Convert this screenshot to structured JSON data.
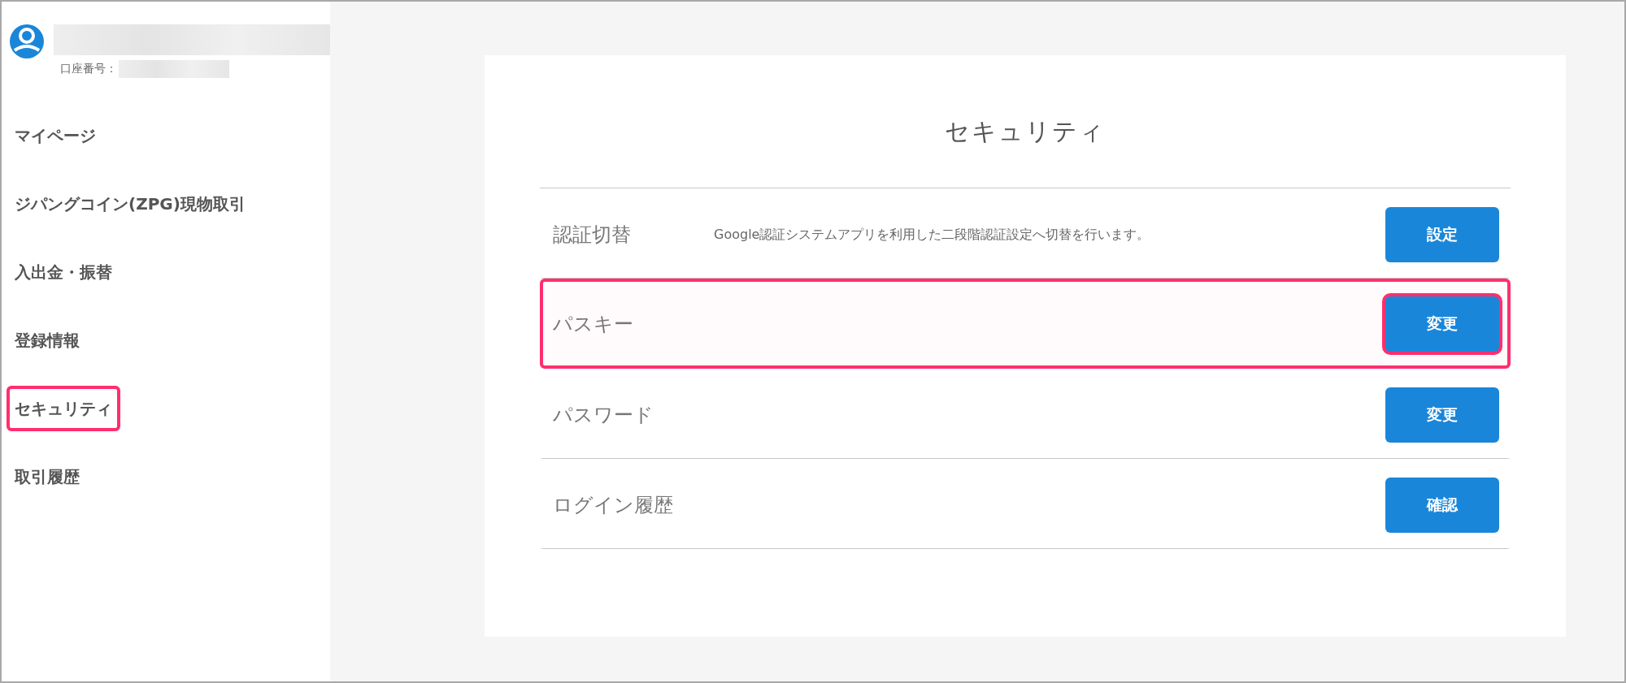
{
  "account": {
    "account_number_label": "口座番号："
  },
  "sidebar": {
    "items": [
      {
        "label": "マイページ",
        "highlighted": false
      },
      {
        "label": "ジパングコイン(ZPG)現物取引",
        "highlighted": false
      },
      {
        "label": "入出金・振替",
        "highlighted": false
      },
      {
        "label": "登録情報",
        "highlighted": false
      },
      {
        "label": "セキュリティ",
        "highlighted": true
      },
      {
        "label": "取引履歴",
        "highlighted": false
      }
    ]
  },
  "panel": {
    "title": "セキュリティ",
    "rows": [
      {
        "label": "認証切替",
        "description": "Google認証システムアプリを利用した二段階認証設定へ切替を行います。",
        "button": "設定",
        "highlighted": false
      },
      {
        "label": "パスキー",
        "button": "変更",
        "highlighted": true
      },
      {
        "label": "パスワード",
        "button": "変更",
        "highlighted": false
      },
      {
        "label": "ログイン履歴",
        "button": "確認",
        "highlighted": false
      }
    ]
  }
}
